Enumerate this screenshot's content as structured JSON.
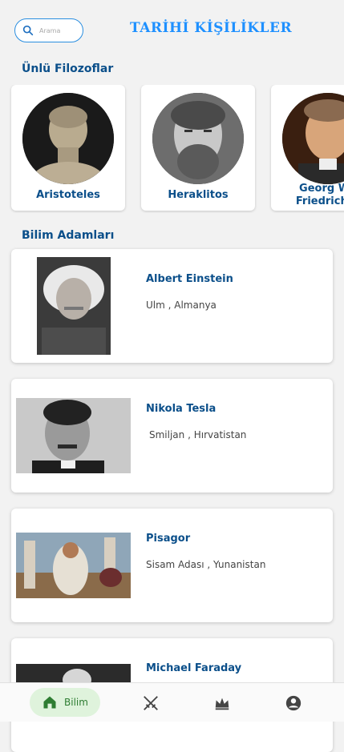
{
  "header": {
    "search_placeholder": "Arama",
    "title": "TARİHİ KİŞİLİKLER"
  },
  "philosophers_section": {
    "title": "Ünlü Filozoflar",
    "items": [
      {
        "name": "Aristoteles"
      },
      {
        "name": "Heraklitos"
      },
      {
        "name": "Georg Wil\nFriedrich H"
      }
    ]
  },
  "scientists_section": {
    "title": "Bilim Adamları",
    "items": [
      {
        "name": "Albert Einstein",
        "place": "Ulm , Almanya"
      },
      {
        "name": "Nikola Tesla",
        "place": "Smiljan , Hırvatistan"
      },
      {
        "name": "Pisagor",
        "place": "Sisam Adası , Yunanistan"
      },
      {
        "name": "Michael Faraday",
        "place": ""
      }
    ]
  },
  "bottom_nav": {
    "active_label": "Bilim",
    "items": [
      "home-icon",
      "swords-icon",
      "crown-icon",
      "account-icon"
    ]
  },
  "colors": {
    "accent": "#1e90ff",
    "section_title": "#0b4f8a",
    "active_nav_bg": "#dff3dc",
    "active_nav_text": "#2e7d32"
  }
}
